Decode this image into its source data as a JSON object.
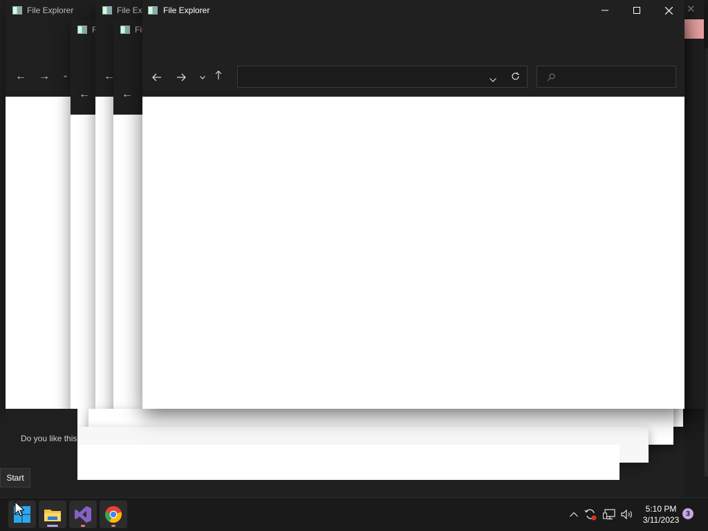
{
  "windows": {
    "ghost_titles": [
      "File Explorer",
      "File Exp",
      "Fil",
      "F",
      "Fil"
    ],
    "front_title": "File Explorer"
  },
  "notification": {
    "text": "Do you like this"
  },
  "tooltip": {
    "text": "Start"
  },
  "taskbar": {
    "apps": [
      "start-icon",
      "file-explorer-icon",
      "visual-studio-icon",
      "chrome-icon"
    ],
    "clock": {
      "time": "5:10 PM",
      "date": "3/11/2023"
    },
    "notification_count": "3"
  },
  "colors": {
    "window_dark": "#202020",
    "taskbar": "#1a1a1a",
    "start_blue": "#29a8f0",
    "vs_purple": "#8661c5",
    "badge": "#c7a6e8"
  }
}
